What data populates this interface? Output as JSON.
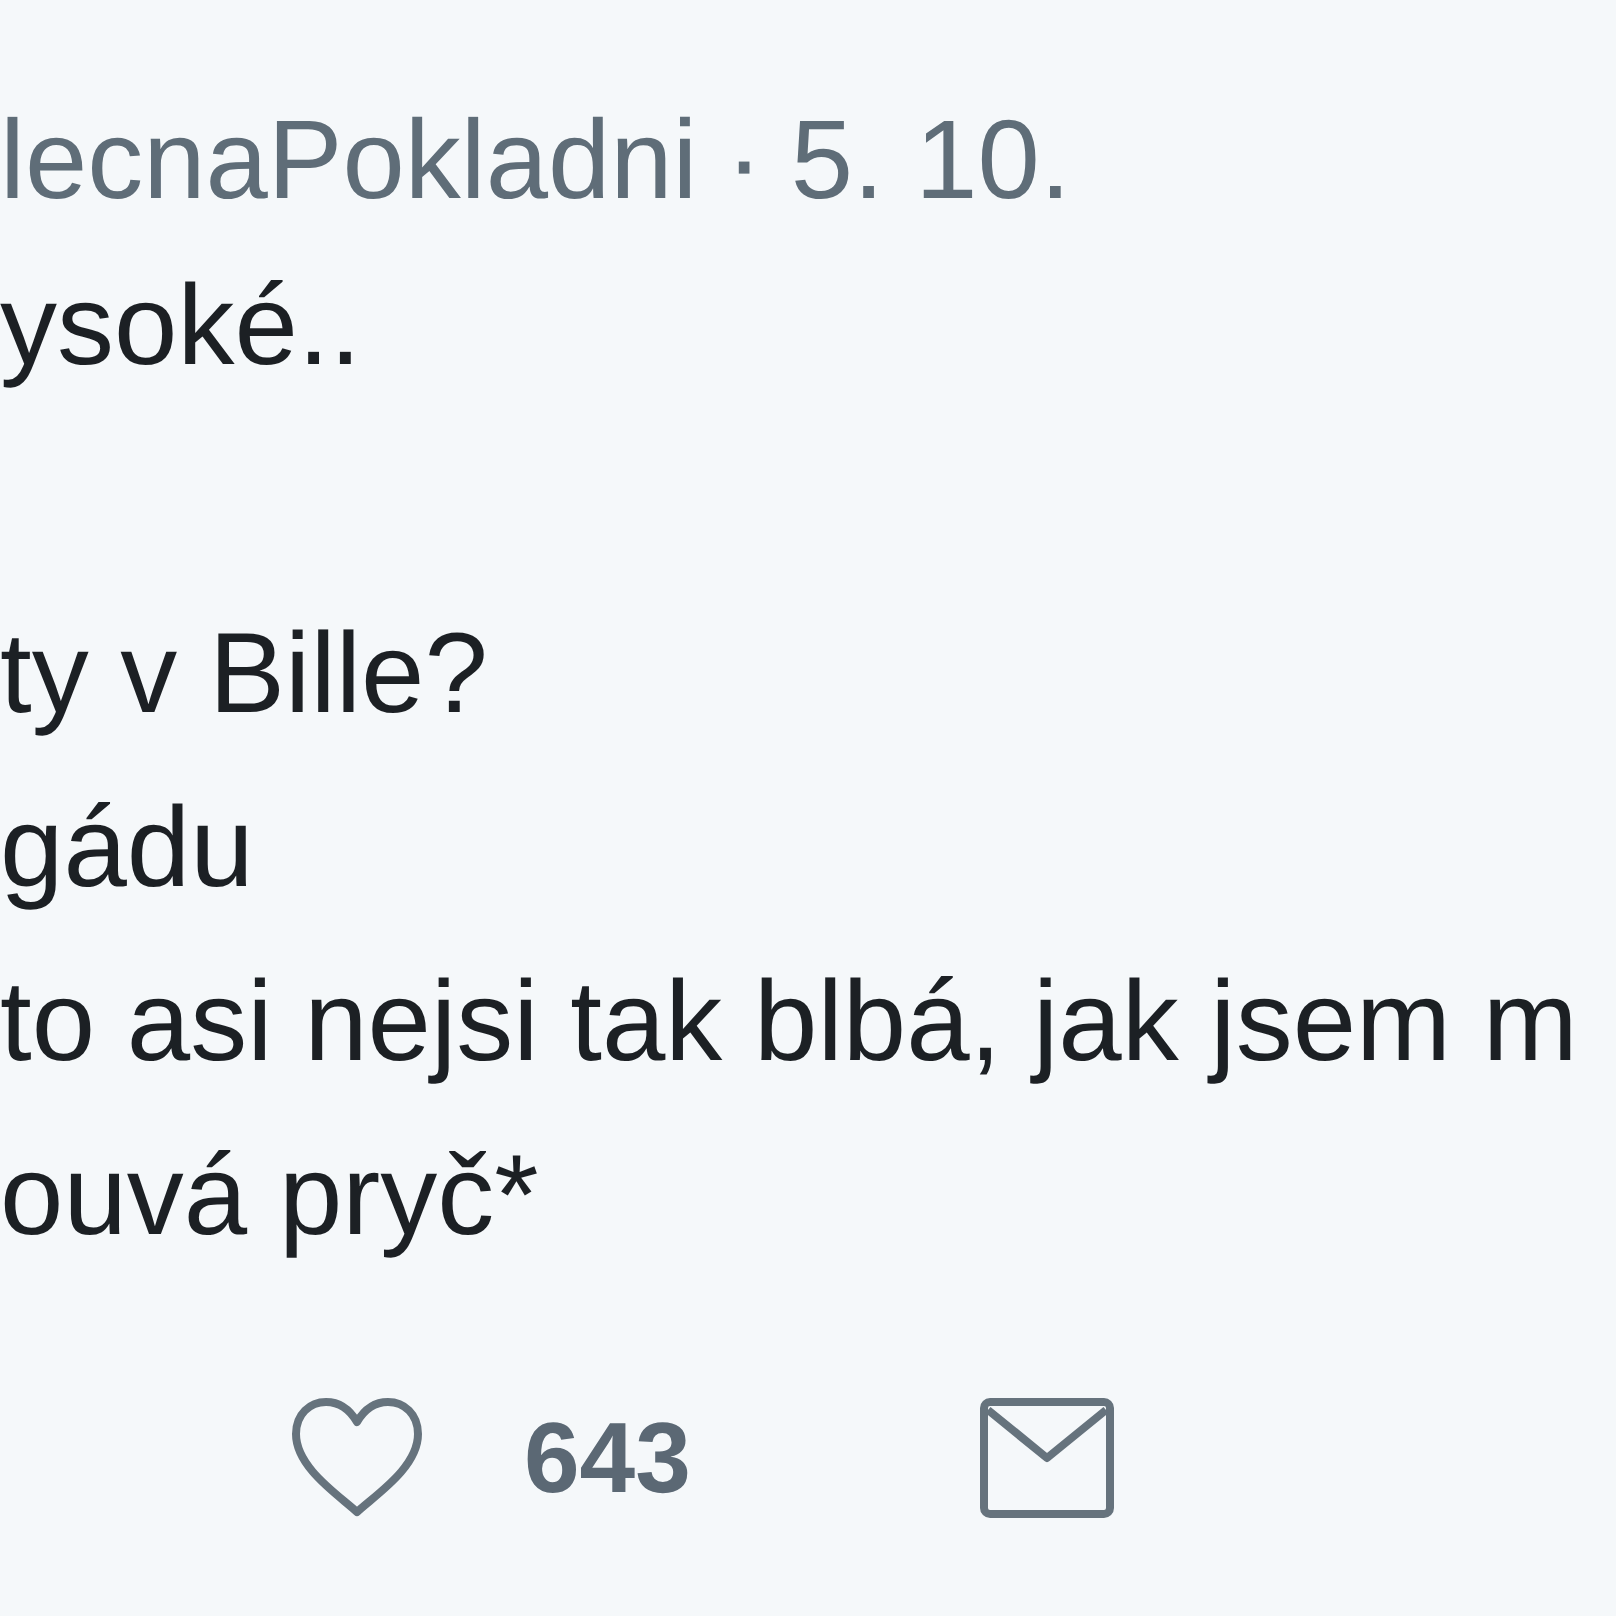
{
  "tweet": {
    "header": {
      "author": "lecnaPokladni",
      "separator": "·",
      "date": "5. 10."
    },
    "paragraphs": [
      [
        "ysoké.."
      ],
      [
        "ty v Bille?",
        "gádu",
        "to asi nejsi tak blbá, jak jsem m",
        "ouvá pryč*"
      ]
    ],
    "actions": [
      {
        "kind": "like",
        "count": "643"
      },
      {
        "kind": "message"
      }
    ]
  }
}
